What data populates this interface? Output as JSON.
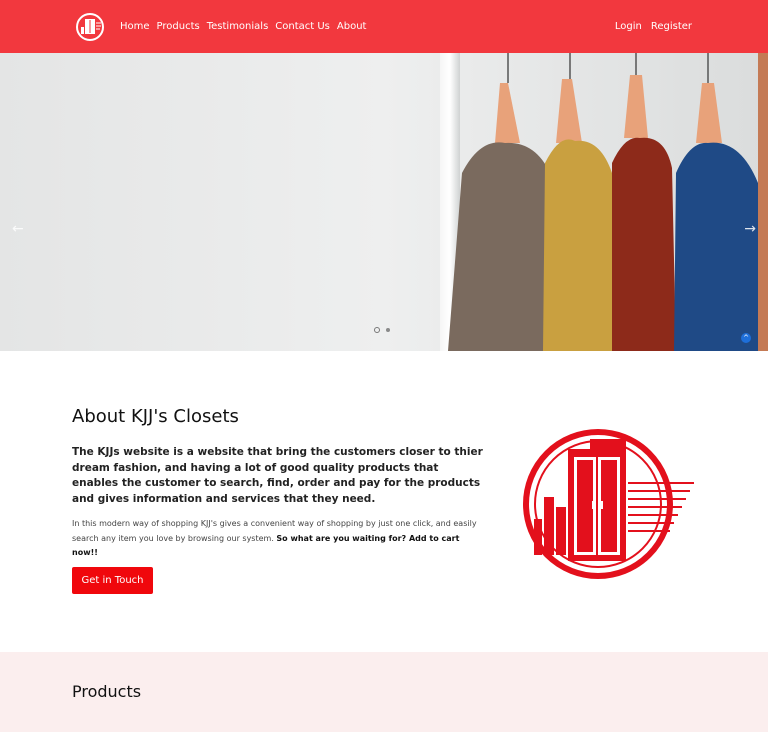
{
  "nav": {
    "brand_icon": "kjj-closet-logo",
    "links": [
      "Home",
      "Products",
      "Testimonials",
      "Contact Us",
      "About"
    ],
    "login": "Login",
    "register": "Register"
  },
  "hero": {
    "prev_icon": "arrow-left-icon",
    "next_icon": "arrow-right-icon",
    "slides": 2,
    "active_slide": 1,
    "back_to_top": "^"
  },
  "about": {
    "title": "About KJJ's Closets",
    "lead": "The KJJs website is a website that bring the customers closer to thier dream fashion, and having a lot of good quality products that enables the customer to search, find, order and pay for the products and gives information and services that they need.",
    "body_text": "In this modern way of shopping KJJ's gives a convenient way of shopping by just one click, and easily search any item you love by browsing our system. ",
    "body_bold": "So what are you waiting for? Add to cart now!!",
    "cta_label": "Get in Touch"
  },
  "products": {
    "title": "Products"
  },
  "colors": {
    "brand_red": "#f2383e",
    "cta_red": "#f0070c",
    "products_bg": "#fbeeee"
  }
}
